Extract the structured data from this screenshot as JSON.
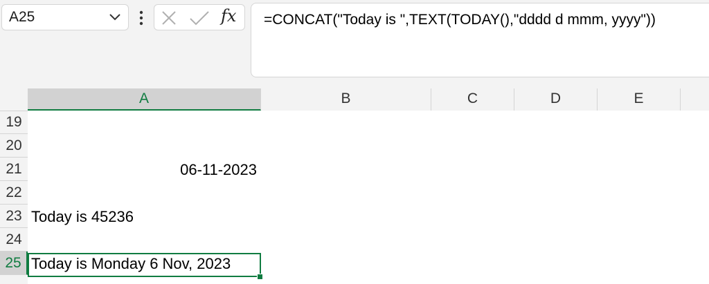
{
  "formula_bar": {
    "name_box": "A25",
    "fx_label": "fx",
    "formula": "=CONCAT(\"Today is \",TEXT(TODAY(),\"dddd d mmm, yyyy\"))"
  },
  "columns": [
    "A",
    "B",
    "C",
    "D",
    "E"
  ],
  "rows": [
    "19",
    "20",
    "21",
    "22",
    "23",
    "24",
    "25"
  ],
  "cells": {
    "A21": "06-11-2023",
    "A23": "Today is 45236",
    "A25": "Today is Monday 6 Nov, 2023"
  },
  "colors": {
    "accent": "#107c41"
  }
}
